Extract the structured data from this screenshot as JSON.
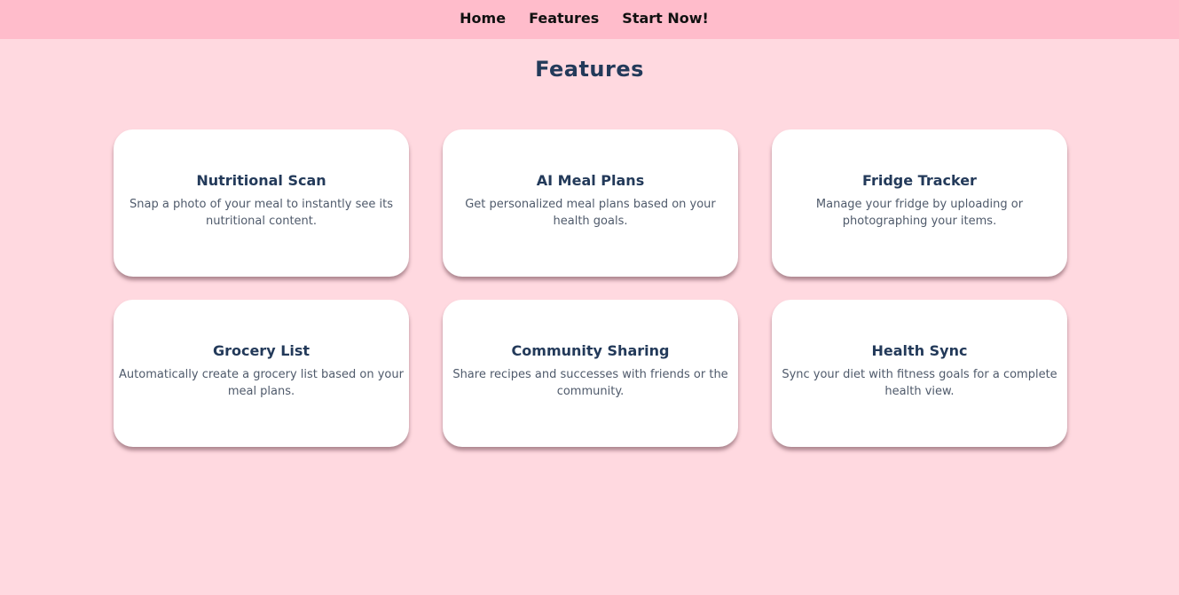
{
  "nav": {
    "items": [
      {
        "label": "Home"
      },
      {
        "label": "Features"
      },
      {
        "label": "Start Now!"
      }
    ]
  },
  "page": {
    "title": "Features"
  },
  "features": [
    {
      "title": "Nutritional Scan",
      "description": "Snap a photo of your meal to instantly see its nutritional content."
    },
    {
      "title": "AI Meal Plans",
      "description": "Get personalized meal plans based on your health goals."
    },
    {
      "title": "Fridge Tracker",
      "description": "Manage your fridge by uploading or photographing your items."
    },
    {
      "title": "Grocery List",
      "description": "Automatically create a grocery list based on your meal plans."
    },
    {
      "title": "Community Sharing",
      "description": "Share recipes and successes with friends or the community."
    },
    {
      "title": "Health Sync",
      "description": "Sync your diet with fitness goals for a complete health view."
    }
  ],
  "colors": {
    "background": "#ffd9e0",
    "navbar": "#ffbccb",
    "card": "#ffffff",
    "title": "#233a5a",
    "text": "#4f5a6b"
  }
}
